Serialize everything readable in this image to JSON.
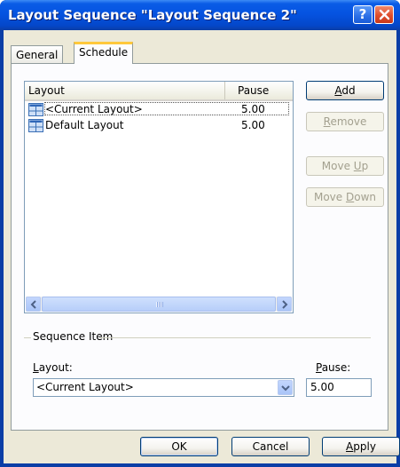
{
  "window": {
    "title": "Layout Sequence \"Layout Sequence 2\"",
    "help_label": "?"
  },
  "tabs": [
    {
      "label": "General"
    },
    {
      "label": "Schedule"
    }
  ],
  "list": {
    "columns": {
      "layout": "Layout",
      "pause": "Pause"
    },
    "rows": [
      {
        "name": "<Current Layout>",
        "pause": "5.00",
        "icon": "layout-grid-icon"
      },
      {
        "name": "Default Layout",
        "pause": "5.00",
        "icon": "layout-grid-icon"
      }
    ],
    "scroll_grip_icon": "scroll-grip-icon"
  },
  "buttons": {
    "add": {
      "pre": "",
      "accel": "A",
      "post": "dd"
    },
    "remove": {
      "pre": "",
      "accel": "R",
      "post": "emove"
    },
    "move_up": {
      "pre": "Move ",
      "accel": "U",
      "post": "p"
    },
    "move_down": {
      "pre": "Move ",
      "accel": "D",
      "post": "own"
    }
  },
  "sequence_item": {
    "group_label": "Sequence Item",
    "layout_label": {
      "pre": "",
      "accel": "L",
      "post": "ayout:"
    },
    "pause_label": {
      "pre": "",
      "accel": "P",
      "post": "ause:"
    },
    "layout_value": "<Current Layout>",
    "pause_value": "5.00"
  },
  "footer": {
    "ok": "OK",
    "cancel": "Cancel",
    "apply": {
      "pre": "",
      "accel": "A",
      "post": "pply"
    }
  },
  "colors": {
    "title_bar": "#0553e1",
    "dialog_bg": "#ece9d8",
    "tab_highlight": "#ffc83c",
    "close_button": "#de4d2b"
  }
}
